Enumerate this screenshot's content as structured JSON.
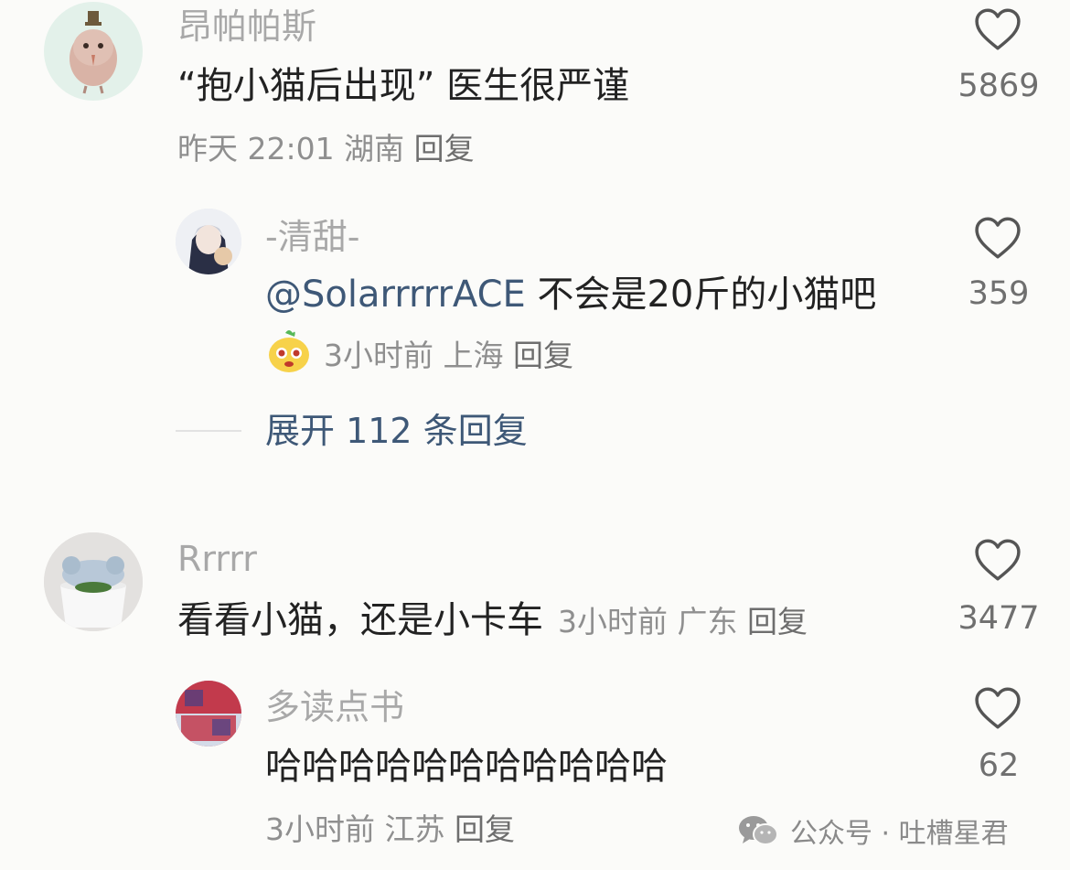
{
  "comments": [
    {
      "user": "昂帕帕斯",
      "text": "“抱小猫后出现” 医生很严谨",
      "time": "昨天 22:01",
      "location": "湖南",
      "reply_label": "回复",
      "likes": "5869",
      "replies": [
        {
          "user": "-清甜-",
          "mention": "@SolarrrrrACE",
          "text": "不会是20斤的小猫吧",
          "time": "3小时前",
          "location": "上海",
          "reply_label": "回复",
          "likes": "359"
        }
      ],
      "expand_label": "展开 112 条回复"
    },
    {
      "user": "Rrrrr",
      "text": "看看小猫，还是小卡车",
      "time": "3小时前",
      "location": "广东",
      "reply_label": "回复",
      "likes": "3477",
      "replies": [
        {
          "user": "多读点书",
          "text": "哈哈哈哈哈哈哈哈哈哈哈",
          "time": "3小时前",
          "location": "江苏",
          "reply_label": "回复",
          "likes": "62"
        }
      ]
    }
  ],
  "watermark": {
    "label": "公众号 · 吐槽星君",
    "icon": "wechat-icon"
  },
  "colors": {
    "background": "#fbfbf9",
    "name": "#a8a8a8",
    "body_text": "#222222",
    "meta": "#8f8f8f",
    "link": "#3e5877",
    "heart": "#555555"
  }
}
